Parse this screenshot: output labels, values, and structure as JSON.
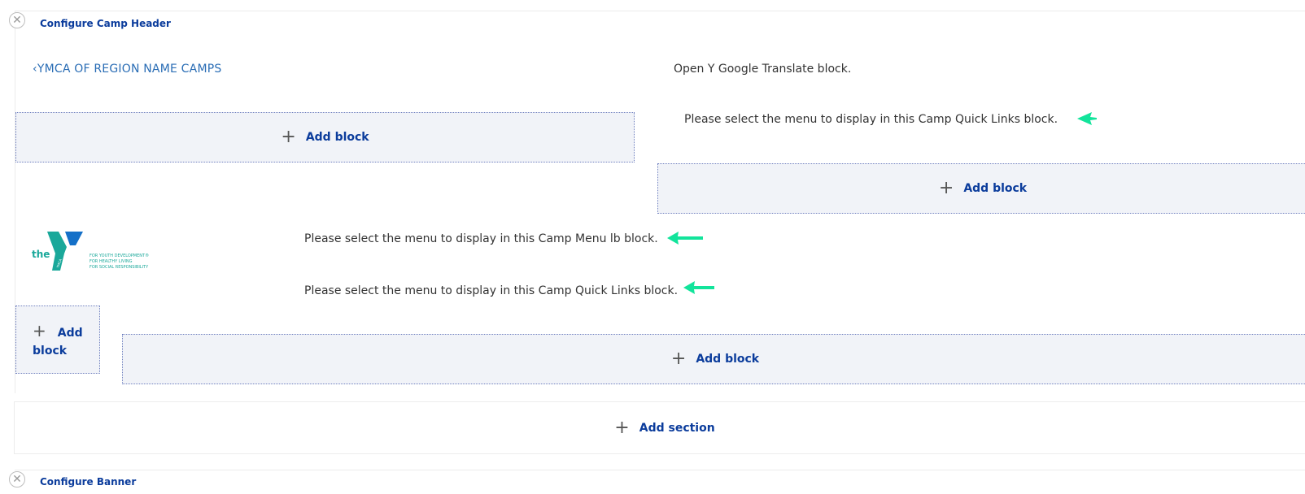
{
  "header_section": {
    "configure_label": "Configure Camp Header",
    "close_symbol": "✕"
  },
  "region_link": {
    "chevron": "‹",
    "label": "YMCA OF REGION NAME CAMPS"
  },
  "blocks": {
    "translate": "Open Y Google Translate block.",
    "quick_links_top": "Please select the menu to display in this Camp Quick Links block.",
    "camp_menu": "Please select the menu to display in this Camp Menu lb block.",
    "quick_links_bottom": "Please select the menu to display in this Camp Quick Links block."
  },
  "add_block": {
    "label": "Add block",
    "label_word1": "Add",
    "label_word2": "block",
    "plus": "+"
  },
  "add_section": {
    "label": "Add section",
    "plus": "+"
  },
  "logo": {
    "the": "the",
    "ymca": "YMCA",
    "line1": "FOR YOUTH DEVELOPMENT®",
    "line2": "FOR HEALTHY LIVING",
    "line3": "FOR SOCIAL RESPONSIBILITY"
  },
  "banner_section": {
    "configure_label": "Configure Banner",
    "close_symbol": "✕"
  },
  "colors": {
    "link_blue": "#0b3c9c",
    "region_blue": "#2a6db5",
    "arrow_green": "#12e49b",
    "ymca_teal": "#1aa89a",
    "ymca_blue": "#1470c8"
  }
}
